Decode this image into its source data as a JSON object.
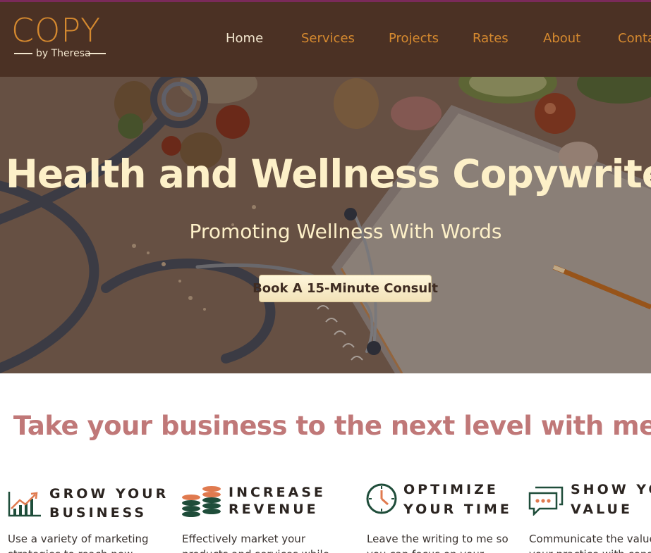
{
  "brand": {
    "name": "COPY",
    "byline": "by Theresa"
  },
  "nav": {
    "items": [
      "Home",
      "Services",
      "Projects",
      "Rates",
      "About",
      "Conta"
    ],
    "active": "Home"
  },
  "hero": {
    "title": "Health and Wellness Copywriter",
    "subtitle": "Promoting Wellness With Words",
    "cta_label": "Book A 15-Minute Consult"
  },
  "tagline": "Take your business to the next level with me!",
  "features": [
    {
      "icon": "growth-chart-icon",
      "title_line1": "GROW YOUR",
      "title_line2": "BUSINESS",
      "text_line1": "Use a variety of marketing",
      "text_line2": "strategies to reach new"
    },
    {
      "icon": "coin-stacks-icon",
      "title_line1": "INCREASE",
      "title_line2": "REVENUE",
      "text_line1": "Effectively market your",
      "text_line2": "products and services while"
    },
    {
      "icon": "clock-icon",
      "title_line1": "OPTIMIZE",
      "title_line2": "YOUR TIME",
      "text_line1": "Leave the writing to me so",
      "text_line2": "you can focus on your"
    },
    {
      "icon": "chat-bubbles-icon",
      "title_line1": "SHOW YO",
      "title_line2": "VALUE",
      "text_line1": "Communicate the value",
      "text_line2": "your practice with consi"
    }
  ],
  "colors": {
    "header_bg": "#4b3124",
    "nav_link": "#d5892f",
    "nav_active": "#f3e7cf",
    "hero_text": "#fdf0c8",
    "tagline": "#c07878",
    "icon_green": "#1f4d3a",
    "icon_orange": "#e07a4f"
  }
}
